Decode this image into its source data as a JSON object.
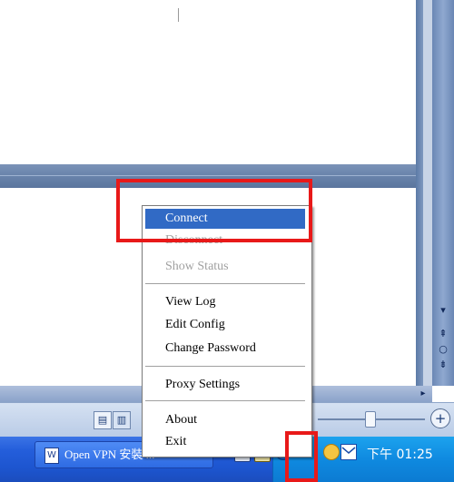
{
  "context_menu": {
    "items": [
      {
        "label": "Connect",
        "state": "selected"
      },
      {
        "label": "Disconnect",
        "state": "disabled"
      },
      {
        "label": "Show Status",
        "state": "disabled"
      },
      {
        "label": "View Log",
        "state": "enabled"
      },
      {
        "label": "Edit Config",
        "state": "enabled"
      },
      {
        "label": "Change Password",
        "state": "enabled"
      },
      {
        "label": "Proxy Settings",
        "state": "enabled"
      },
      {
        "label": "About",
        "state": "enabled"
      },
      {
        "label": "Exit",
        "state": "enabled"
      }
    ]
  },
  "taskbar": {
    "task_button_label": "Open VPN 安裝 ...",
    "task_button_icon": "W",
    "clock": "下午 01:25"
  },
  "navigation": {
    "prev_icon": "double-up-arrow",
    "select_browse_icon": "circle",
    "next_icon": "double-down-arrow"
  },
  "colors": {
    "menu_selection": "#316ac5",
    "highlight_box": "#e81919",
    "taskbar": "#245edb",
    "tray": "#0f8ae0"
  }
}
